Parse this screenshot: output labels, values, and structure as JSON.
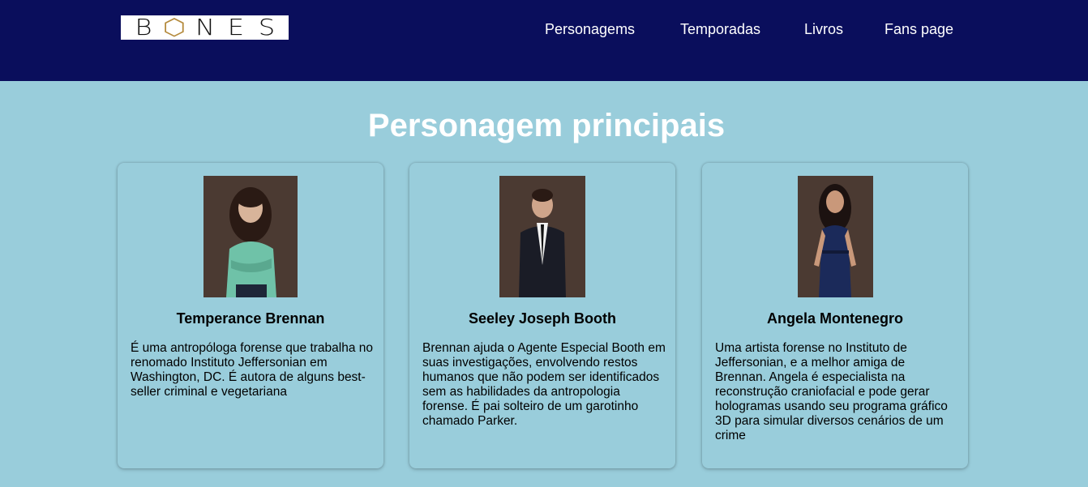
{
  "header": {
    "logo_letters": [
      "B",
      "⬡",
      "N",
      "E",
      "S"
    ],
    "nav": [
      {
        "label": "Personagems"
      },
      {
        "label": "Temporadas"
      },
      {
        "label": "Livros"
      },
      {
        "label": "Fans page"
      }
    ],
    "colors": {
      "background": "#0a0e5c",
      "text": "#ffffff"
    }
  },
  "main": {
    "title": "Personagem principais",
    "background": "#99cddb",
    "cards": [
      {
        "photo_alt": "Temperance Brennan",
        "name": "Temperance Brennan",
        "description": "É uma antropóloga forense que trabalha no renomado Instituto Jeffersonian em Washington, DC. É autora de alguns best-seller criminal e vegetariana"
      },
      {
        "photo_alt": "Seeley Joseph Booth",
        "name": "Seeley Joseph Booth",
        "description": "Brennan ajuda o Agente Especial Booth em suas investigações, envolvendo restos humanos que não podem ser identificados sem as habilidades da antropologia forense. É pai solteiro de um garotinho chamado Parker."
      },
      {
        "photo_alt": "Angela Montenegro",
        "name": "Angela Montenegro",
        "description": "Uma artista forense no Instituto de Jeffersonian, e a melhor amiga de Brennan. Angela é especialista na reconstrução craniofacial e pode gerar hologramas usando seu programa gráfico 3D para simular diversos cenários de um crime"
      }
    ]
  }
}
